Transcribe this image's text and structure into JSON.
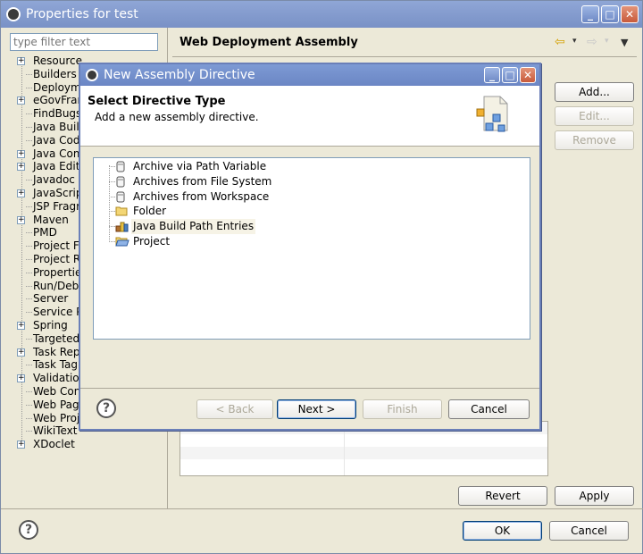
{
  "window": {
    "title": "Properties for test",
    "filter_placeholder": "type filter text",
    "tree": [
      "Resource",
      "Builders",
      "Deployme",
      "eGovFram",
      "FindBugs",
      "Java Build",
      "Java Cod",
      "Java Com",
      "Java Edito",
      "Javadoc L",
      "JavaScrip",
      "JSP Fragr",
      "Maven",
      "PMD",
      "Project Fa",
      "Project Re",
      "Properties",
      "Run/Debu",
      "Server",
      "Service P",
      "Spring",
      "Targeted",
      "Task Rep",
      "Task Tag",
      "Validation",
      "Web Cont",
      "Web Page",
      "Web Proje",
      "WikiText",
      "XDoclet"
    ],
    "expandable": [
      0,
      3,
      7,
      8,
      10,
      12,
      20,
      22,
      24,
      29
    ],
    "page_title": "Web Deployment Assembly",
    "buttons": {
      "add": "Add...",
      "edit": "Edit...",
      "remove": "Remove",
      "revert": "Revert",
      "apply": "Apply",
      "ok": "OK",
      "cancel": "Cancel"
    }
  },
  "dialog": {
    "title": "New Assembly Directive",
    "heading": "Select Directive Type",
    "subheading": "Add a new assembly directive.",
    "items": [
      "Archive via Path Variable",
      "Archives from File System",
      "Archives from Workspace",
      "Folder",
      "Java Build Path Entries",
      "Project"
    ],
    "item_icons": [
      "jar-icon",
      "jar-icon",
      "jar-icon",
      "folder-icon",
      "library-icon",
      "project-folder-icon"
    ],
    "selected_index": 4,
    "buttons": {
      "back": "< Back",
      "next": "Next >",
      "finish": "Finish",
      "cancel": "Cancel"
    }
  },
  "colors": {
    "titlebar": "#7991c6",
    "dialog_border": "#6a7fb8",
    "window_bg": "#ece9d8"
  }
}
